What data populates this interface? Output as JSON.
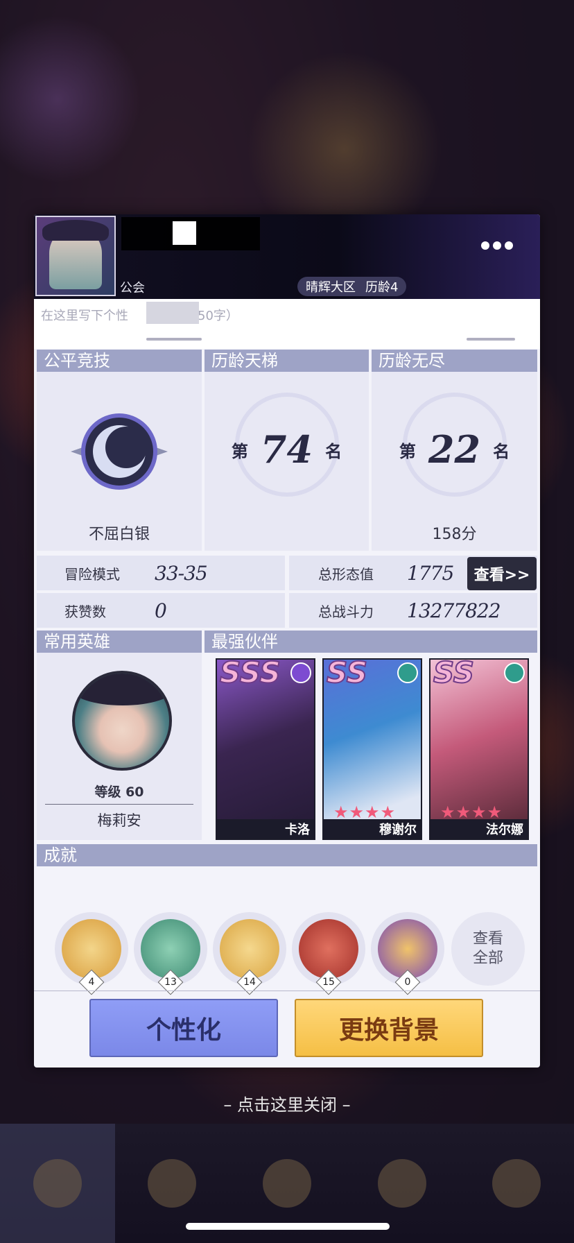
{
  "header": {
    "guild_label": "公会",
    "server": "晴辉大区",
    "age": "历龄4"
  },
  "bio": {
    "placeholder_prefix": "在这里写下个性",
    "placeholder_suffix": "50字）"
  },
  "rankings": {
    "fair_arena": {
      "title": "公平竞技",
      "tier": "不屈白银"
    },
    "ladder": {
      "title": "历龄天梯",
      "prefix": "第",
      "rank": "74",
      "suffix": "名"
    },
    "endless": {
      "title": "历龄无尽",
      "prefix": "第",
      "rank": "22",
      "suffix": "名",
      "score": "158分"
    }
  },
  "stats": {
    "adventure_label": "冒险模式",
    "adventure_value": "33-35",
    "likes_label": "获赞数",
    "likes_value": "0",
    "form_label": "总形态值",
    "form_value": "1775",
    "power_label": "总战斗力",
    "power_value": "13277822",
    "view_button": "查看>>"
  },
  "common_hero": {
    "title": "常用英雄",
    "level": "等级 60",
    "name": "梅莉安"
  },
  "partners": {
    "title": "最强伙伴",
    "cards": [
      {
        "grade": "SSS",
        "name": "卡洛",
        "stars": "",
        "element_color": "#7d4bd1"
      },
      {
        "grade": "SS",
        "name": "穆谢尔",
        "stars": "★★★★",
        "element_color": "#2f9c8c"
      },
      {
        "grade": "SS",
        "name": "法尔娜",
        "stars": "★★★★",
        "element_color": "#2f9c8c"
      }
    ]
  },
  "achievements": {
    "title": "成就",
    "items": [
      {
        "count": "4",
        "color": "#e4b05a"
      },
      {
        "count": "13",
        "color": "#4f9c86"
      },
      {
        "count": "14",
        "color": "#e6b04f"
      },
      {
        "count": "15",
        "color": "#c9473d"
      },
      {
        "count": "0",
        "color": "#8b57c4"
      }
    ],
    "view_all_line1": "查看",
    "view_all_line2": "全部"
  },
  "buttons": {
    "personalize": "个性化",
    "change_background": "更换背景"
  },
  "close_hint": "– 点击这里关闭 –"
}
